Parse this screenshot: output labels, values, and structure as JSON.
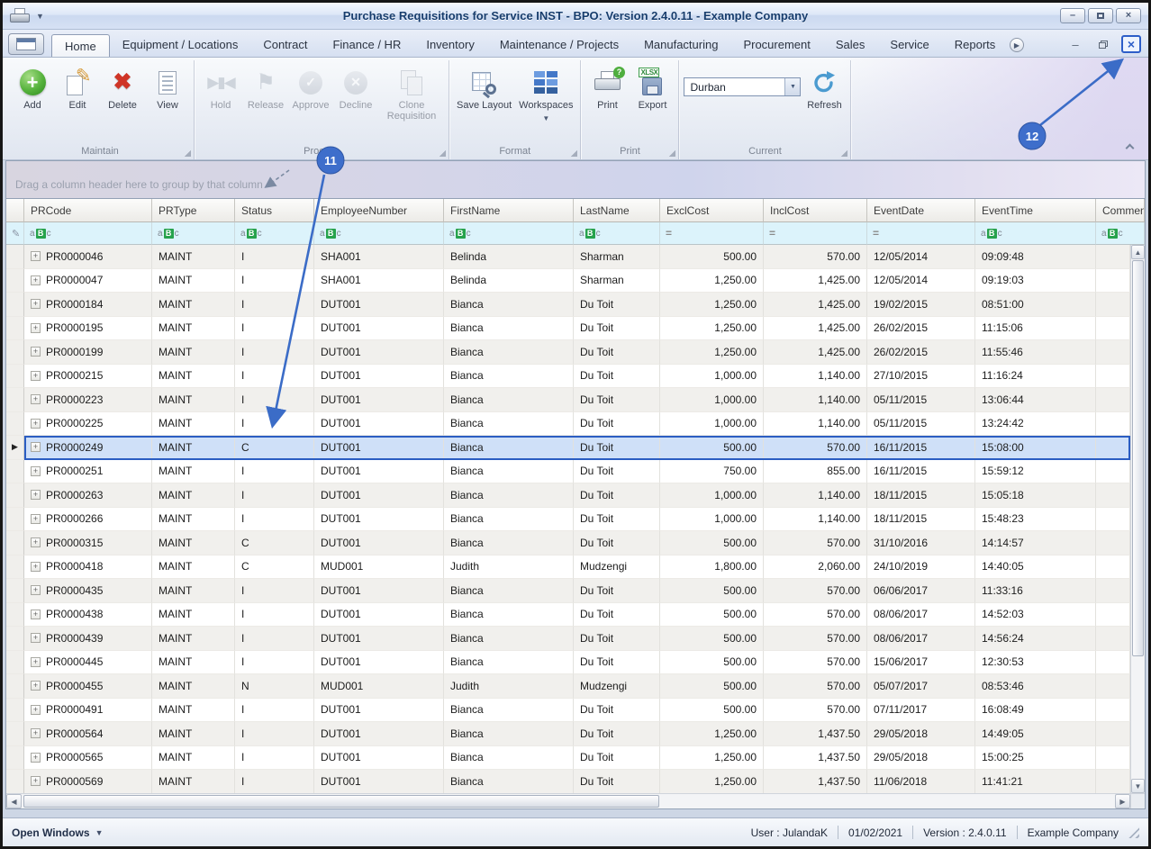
{
  "window": {
    "title": "Purchase Requisitions for Service INST - BPO: Version 2.4.0.11 - Example Company"
  },
  "ribbon_tabs": {
    "items": [
      "Home",
      "Equipment / Locations",
      "Contract",
      "Finance / HR",
      "Inventory",
      "Maintenance / Projects",
      "Manufacturing",
      "Procurement",
      "Sales",
      "Service",
      "Reports"
    ],
    "active": "Home"
  },
  "ribbon": {
    "maintain": {
      "label": "Maintain",
      "add": "Add",
      "edit": "Edit",
      "del": "Delete",
      "view": "View"
    },
    "process": {
      "label": "Process",
      "hold": "Hold",
      "release": "Release",
      "approve": "Approve",
      "decline": "Decline",
      "clone": "Clone Requisition"
    },
    "format": {
      "label": "Format",
      "save_layout": "Save Layout",
      "workspaces": "Workspaces"
    },
    "print": {
      "label": "Print",
      "print": "Print",
      "export": "Export",
      "export_tag": "XLSX"
    },
    "current": {
      "label": "Current",
      "site": "Durban",
      "refresh": "Refresh"
    }
  },
  "grid": {
    "group_hint": "Drag a column header here to group by that column",
    "columns": [
      "PRCode",
      "PRType",
      "Status",
      "EmployeeNumber",
      "FirstName",
      "LastName",
      "ExclCost",
      "InclCost",
      "EventDate",
      "EventTime",
      "Comments"
    ],
    "column_keys": [
      "prcode",
      "prtype",
      "status",
      "employeenumber",
      "firstname",
      "lastname",
      "exclcost",
      "inclcost",
      "eventdate",
      "eventtime"
    ],
    "selected_index": 8,
    "rows": [
      [
        "PR0000046",
        "MAINT",
        "I",
        "SHA001",
        "Belinda",
        "Sharman",
        "500.00",
        "570.00",
        "12/05/2014",
        "09:09:48"
      ],
      [
        "PR0000047",
        "MAINT",
        "I",
        "SHA001",
        "Belinda",
        "Sharman",
        "1,250.00",
        "1,425.00",
        "12/05/2014",
        "09:19:03"
      ],
      [
        "PR0000184",
        "MAINT",
        "I",
        "DUT001",
        "Bianca",
        "Du Toit",
        "1,250.00",
        "1,425.00",
        "19/02/2015",
        "08:51:00"
      ],
      [
        "PR0000195",
        "MAINT",
        "I",
        "DUT001",
        "Bianca",
        "Du Toit",
        "1,250.00",
        "1,425.00",
        "26/02/2015",
        "11:15:06"
      ],
      [
        "PR0000199",
        "MAINT",
        "I",
        "DUT001",
        "Bianca",
        "Du Toit",
        "1,250.00",
        "1,425.00",
        "26/02/2015",
        "11:55:46"
      ],
      [
        "PR0000215",
        "MAINT",
        "I",
        "DUT001",
        "Bianca",
        "Du Toit",
        "1,000.00",
        "1,140.00",
        "27/10/2015",
        "11:16:24"
      ],
      [
        "PR0000223",
        "MAINT",
        "I",
        "DUT001",
        "Bianca",
        "Du Toit",
        "1,000.00",
        "1,140.00",
        "05/11/2015",
        "13:06:44"
      ],
      [
        "PR0000225",
        "MAINT",
        "I",
        "DUT001",
        "Bianca",
        "Du Toit",
        "1,000.00",
        "1,140.00",
        "05/11/2015",
        "13:24:42"
      ],
      [
        "PR0000249",
        "MAINT",
        "C",
        "DUT001",
        "Bianca",
        "Du Toit",
        "500.00",
        "570.00",
        "16/11/2015",
        "15:08:00"
      ],
      [
        "PR0000251",
        "MAINT",
        "I",
        "DUT001",
        "Bianca",
        "Du Toit",
        "750.00",
        "855.00",
        "16/11/2015",
        "15:59:12"
      ],
      [
        "PR0000263",
        "MAINT",
        "I",
        "DUT001",
        "Bianca",
        "Du Toit",
        "1,000.00",
        "1,140.00",
        "18/11/2015",
        "15:05:18"
      ],
      [
        "PR0000266",
        "MAINT",
        "I",
        "DUT001",
        "Bianca",
        "Du Toit",
        "1,000.00",
        "1,140.00",
        "18/11/2015",
        "15:48:23"
      ],
      [
        "PR0000315",
        "MAINT",
        "C",
        "DUT001",
        "Bianca",
        "Du Toit",
        "500.00",
        "570.00",
        "31/10/2016",
        "14:14:57"
      ],
      [
        "PR0000418",
        "MAINT",
        "C",
        "MUD001",
        "Judith",
        "Mudzengi",
        "1,800.00",
        "2,060.00",
        "24/10/2019",
        "14:40:05"
      ],
      [
        "PR0000435",
        "MAINT",
        "I",
        "DUT001",
        "Bianca",
        "Du Toit",
        "500.00",
        "570.00",
        "06/06/2017",
        "11:33:16"
      ],
      [
        "PR0000438",
        "MAINT",
        "I",
        "DUT001",
        "Bianca",
        "Du Toit",
        "500.00",
        "570.00",
        "08/06/2017",
        "14:52:03"
      ],
      [
        "PR0000439",
        "MAINT",
        "I",
        "DUT001",
        "Bianca",
        "Du Toit",
        "500.00",
        "570.00",
        "08/06/2017",
        "14:56:24"
      ],
      [
        "PR0000445",
        "MAINT",
        "I",
        "DUT001",
        "Bianca",
        "Du Toit",
        "500.00",
        "570.00",
        "15/06/2017",
        "12:30:53"
      ],
      [
        "PR0000455",
        "MAINT",
        "N",
        "MUD001",
        "Judith",
        "Mudzengi",
        "500.00",
        "570.00",
        "05/07/2017",
        "08:53:46"
      ],
      [
        "PR0000491",
        "MAINT",
        "I",
        "DUT001",
        "Bianca",
        "Du Toit",
        "500.00",
        "570.00",
        "07/11/2017",
        "16:08:49"
      ],
      [
        "PR0000564",
        "MAINT",
        "I",
        "DUT001",
        "Bianca",
        "Du Toit",
        "1,250.00",
        "1,437.50",
        "29/05/2018",
        "14:49:05"
      ],
      [
        "PR0000565",
        "MAINT",
        "I",
        "DUT001",
        "Bianca",
        "Du Toit",
        "1,250.00",
        "1,437.50",
        "29/05/2018",
        "15:00:25"
      ],
      [
        "PR0000569",
        "MAINT",
        "I",
        "DUT001",
        "Bianca",
        "Du Toit",
        "1,250.00",
        "1,437.50",
        "11/06/2018",
        "11:41:21"
      ]
    ]
  },
  "statusbar": {
    "open_windows": "Open Windows",
    "user": "User : JulandaK",
    "date": "01/02/2021",
    "version": "Version : 2.4.0.11",
    "company": "Example Company"
  },
  "annotations": {
    "step11": "11",
    "step12": "12"
  }
}
